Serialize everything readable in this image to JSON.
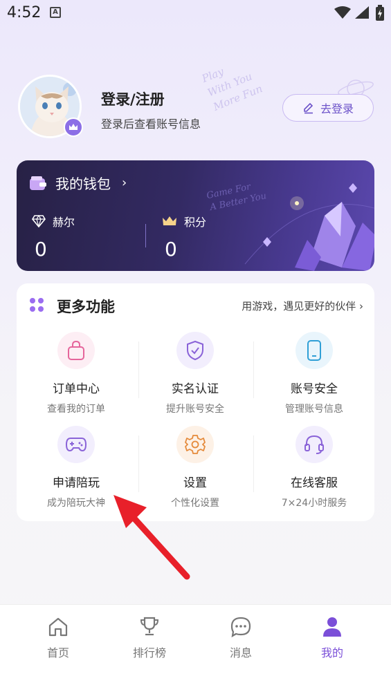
{
  "status_bar": {
    "time": "4:52"
  },
  "profile": {
    "login_title": "登录/注册",
    "login_subtitle": "登录后查看账号信息",
    "login_button": "去登录"
  },
  "wallet": {
    "title": "我的钱包",
    "arrow": "›",
    "stats": [
      {
        "label": "赫尔",
        "value": "0",
        "icon": "diamond-icon"
      },
      {
        "label": "积分",
        "value": "0",
        "icon": "crown-icon"
      }
    ]
  },
  "functions": {
    "title": "更多功能",
    "link": "用游戏，遇见更好的伙伴 ›",
    "items": [
      {
        "label": "订单中心",
        "sub": "查看我的订单",
        "icon": "bag-icon"
      },
      {
        "label": "实名认证",
        "sub": "提升账号安全",
        "icon": "shield-icon"
      },
      {
        "label": "账号安全",
        "sub": "管理账号信息",
        "icon": "phone-icon"
      },
      {
        "label": "申请陪玩",
        "sub": "成为陪玩大神",
        "icon": "gamepad-icon"
      },
      {
        "label": "设置",
        "sub": "个性化设置",
        "icon": "gear-icon"
      },
      {
        "label": "在线客服",
        "sub": "7×24小时服务",
        "icon": "headset-icon"
      }
    ]
  },
  "tabs": [
    {
      "label": "首页",
      "icon": "home-icon"
    },
    {
      "label": "排行榜",
      "icon": "trophy-icon"
    },
    {
      "label": "消息",
      "icon": "chat-icon"
    },
    {
      "label": "我的",
      "icon": "person-icon",
      "active": true
    }
  ],
  "colors": {
    "accent": "#7b4fd8",
    "wallet_bg": "#2e2757",
    "annotation_arrow": "#e8202a"
  }
}
